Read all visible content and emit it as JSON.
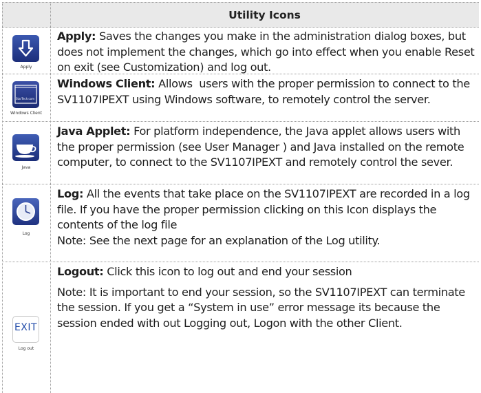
{
  "header": {
    "title": "Utility Icons"
  },
  "rows": [
    {
      "icon": "apply-arrow-down-icon",
      "caption": "Apply",
      "term": "Apply:",
      "text": " Saves the changes you make in the administration dialog boxes, but does not implement the changes, which go into effect when you enable Reset on exit (see Customization) and log out."
    },
    {
      "icon": "windows-client-icon",
      "caption": "Windows Client",
      "term": "Windows Client:",
      "text": " Allows  users with the proper permission to connect to the SV1107IPEXT using Windows software, to remotely control the server.",
      "icon_label": "StarTech.com"
    },
    {
      "icon": "java-cup-icon",
      "caption": "Java",
      "term": "Java Applet:",
      "text": " For platform independence, the Java applet allows users with the proper permission (see User Manager ) and Java installed on the remote computer, to connect to the SV1107IPEXT and remotely control the sever."
    },
    {
      "icon": "clock-icon",
      "caption": "Log",
      "term": "Log:",
      "text": " All the events that take place on the SV1107IPEXT are recorded in a log file. If you have the proper permission clicking on this Icon displays the contents of the log file",
      "note": "Note: See the next page for an explanation of the Log utility."
    },
    {
      "icon": "exit-icon",
      "caption": "Log out",
      "icon_label": "EXIT",
      "term": "Logout:",
      "text": " Click this icon to log out and end your session",
      "note": "Note: It is important to end your session, so the SV1107IPEXT can terminate the session. If you get a “System in use” error message its because the session ended with out Logging out, Logon with the other Client."
    }
  ],
  "colors": {
    "icon_blue": "#1c2e7a",
    "header_bg": "#e9e9e9",
    "exit_text": "#1f4aa8"
  }
}
